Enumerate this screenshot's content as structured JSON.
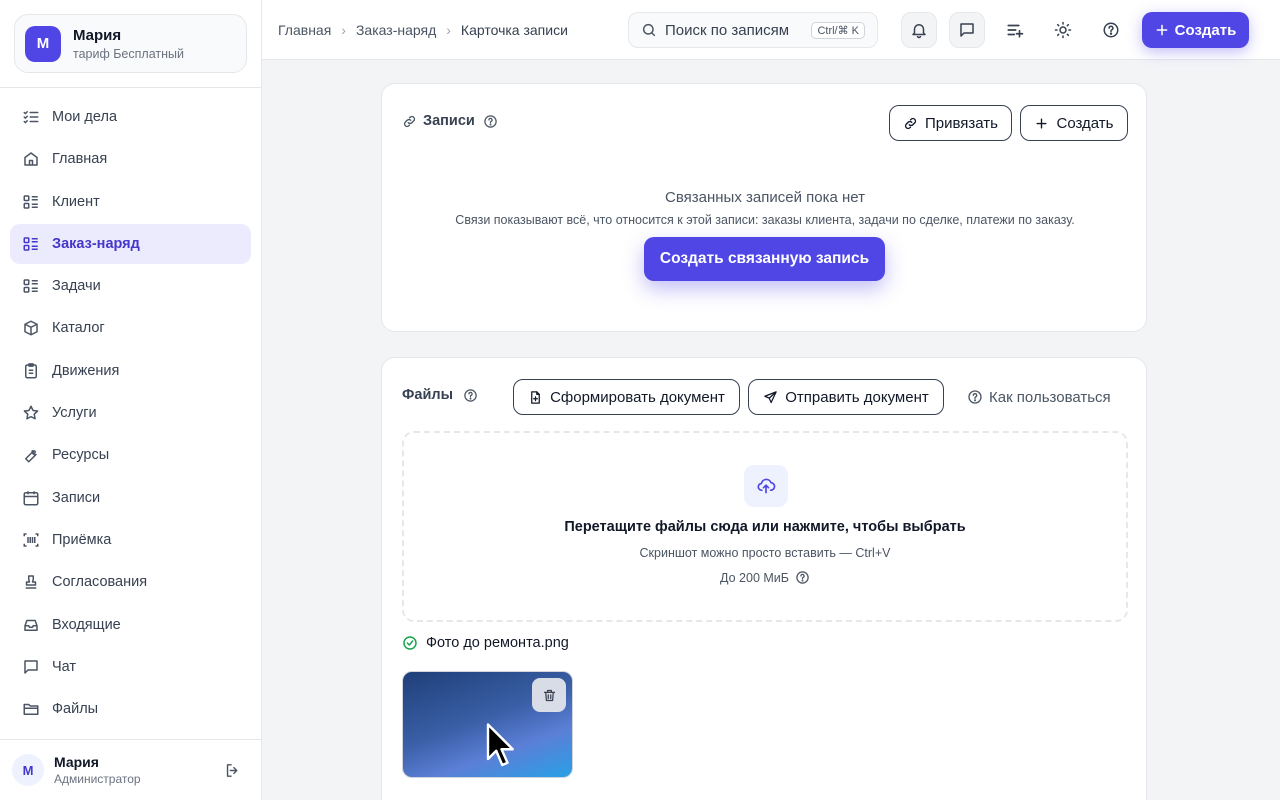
{
  "org": {
    "avatar": "М",
    "name": "Мария",
    "plan": "тариф Бесплатный"
  },
  "nav": [
    {
      "label": "Мои дела",
      "icon": "checklist-icon"
    },
    {
      "label": "Главная",
      "icon": "home-icon"
    },
    {
      "label": "Клиент",
      "icon": "list-icon"
    },
    {
      "label": "Заказ-наряд",
      "icon": "list-icon",
      "active": true
    },
    {
      "label": "Задачи",
      "icon": "list-icon"
    },
    {
      "label": "Каталог",
      "icon": "box-icon"
    },
    {
      "label": "Движения",
      "icon": "clipboard-icon"
    },
    {
      "label": "Услуги",
      "icon": "star-icon"
    },
    {
      "label": "Ресурсы",
      "icon": "wrench-icon"
    },
    {
      "label": "Записи",
      "icon": "calendar-icon"
    },
    {
      "label": "Приёмка",
      "icon": "scan-icon"
    },
    {
      "label": "Согласования",
      "icon": "stamp-icon"
    },
    {
      "label": "Входящие",
      "icon": "inbox-icon"
    },
    {
      "label": "Чат",
      "icon": "chat-icon"
    },
    {
      "label": "Файлы",
      "icon": "folder-icon"
    }
  ],
  "user": {
    "avatar": "М",
    "name": "Мария",
    "role": "Администратор"
  },
  "breadcrumbs": [
    "Главная",
    "Заказ-наряд",
    "Карточка записи"
  ],
  "search": {
    "placeholder": "Поиск по записям",
    "shortcut": "Ctrl/⌘ K"
  },
  "topbar": {
    "create_label": "Создать"
  },
  "records": {
    "title": "Записи",
    "link_label": "Привязать",
    "create_label": "Создать",
    "empty_title": "Связанных записей пока нет",
    "empty_desc": "Связи показывают всё, что относится к этой записи: заказы клиента, задачи по сделке, платежи по заказу.",
    "create_linked_label": "Создать связанную запись"
  },
  "files": {
    "title": "Файлы",
    "generate_label": "Сформировать документ",
    "send_label": "Отправить документ",
    "howto_label": "Как пользоваться",
    "dropzone_title": "Перетащите файлы сюда или нажмите, чтобы выбрать",
    "dropzone_hint": "Скриншот можно просто вставить — Ctrl+V",
    "dropzone_limit": "До 200 МиБ",
    "uploaded_file": "Фото до ремонта.png"
  },
  "colors": {
    "accent": "#4f46e5",
    "active_bg": "#eceafd",
    "success": "#16a34a"
  }
}
